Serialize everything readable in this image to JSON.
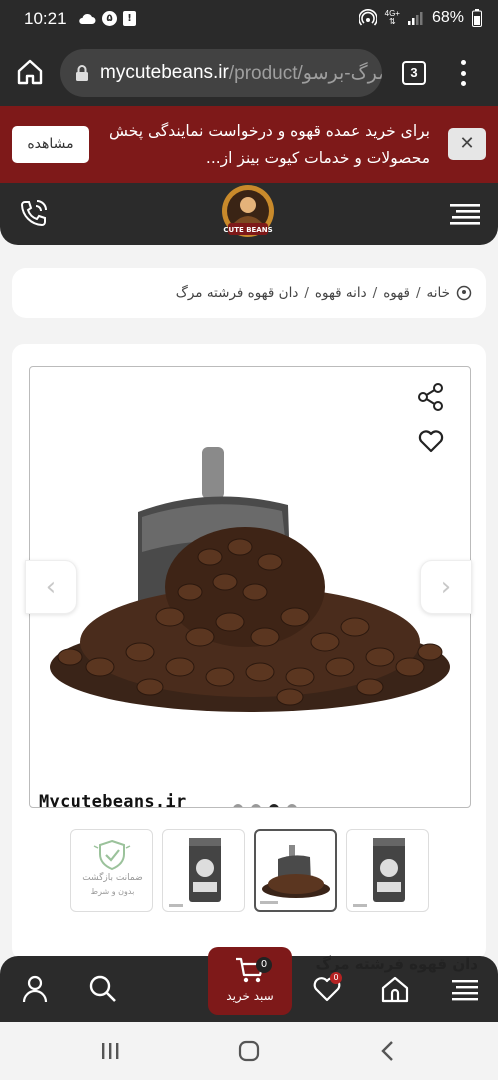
{
  "status_bar": {
    "time": "10:21",
    "left_badges": [
      "۵",
      "!"
    ],
    "network_label_top": "4G+",
    "battery": "68%"
  },
  "browser": {
    "url_domain": "mycutebeans.ir",
    "url_path": "/product/دان-قهوه-فرشته-مرگ-برسو",
    "tab_count": "3"
  },
  "promo": {
    "text": "برای خرید عمده قهوه و درخواست نمایندگی پخش محصولات و خدمات کیوت بینز از...",
    "view_button": "مشاهده",
    "close": "✕"
  },
  "site_header": {
    "logo_text": "CUTE BEANS"
  },
  "breadcrumb": {
    "items": [
      "خانه",
      "قهوه",
      "دانه قهوه",
      "دان قهوه فرشته مرگ"
    ],
    "separator": "/"
  },
  "product": {
    "watermark": "Mycutebeans.ir",
    "carousel_count": 4,
    "carousel_active_index": 2,
    "thumbnails": {
      "guarantee_title": "ضمانت بازگشت",
      "guarantee_sub": "بدون و شرط"
    },
    "title": "دان قهوه فرشته مرگ"
  },
  "bottom_nav": {
    "cart_label": "سبد خرید",
    "cart_count": "0",
    "wishlist_count": "0"
  },
  "colors": {
    "brand_red": "#7e1919",
    "dark_bar": "#2b2b2b"
  }
}
